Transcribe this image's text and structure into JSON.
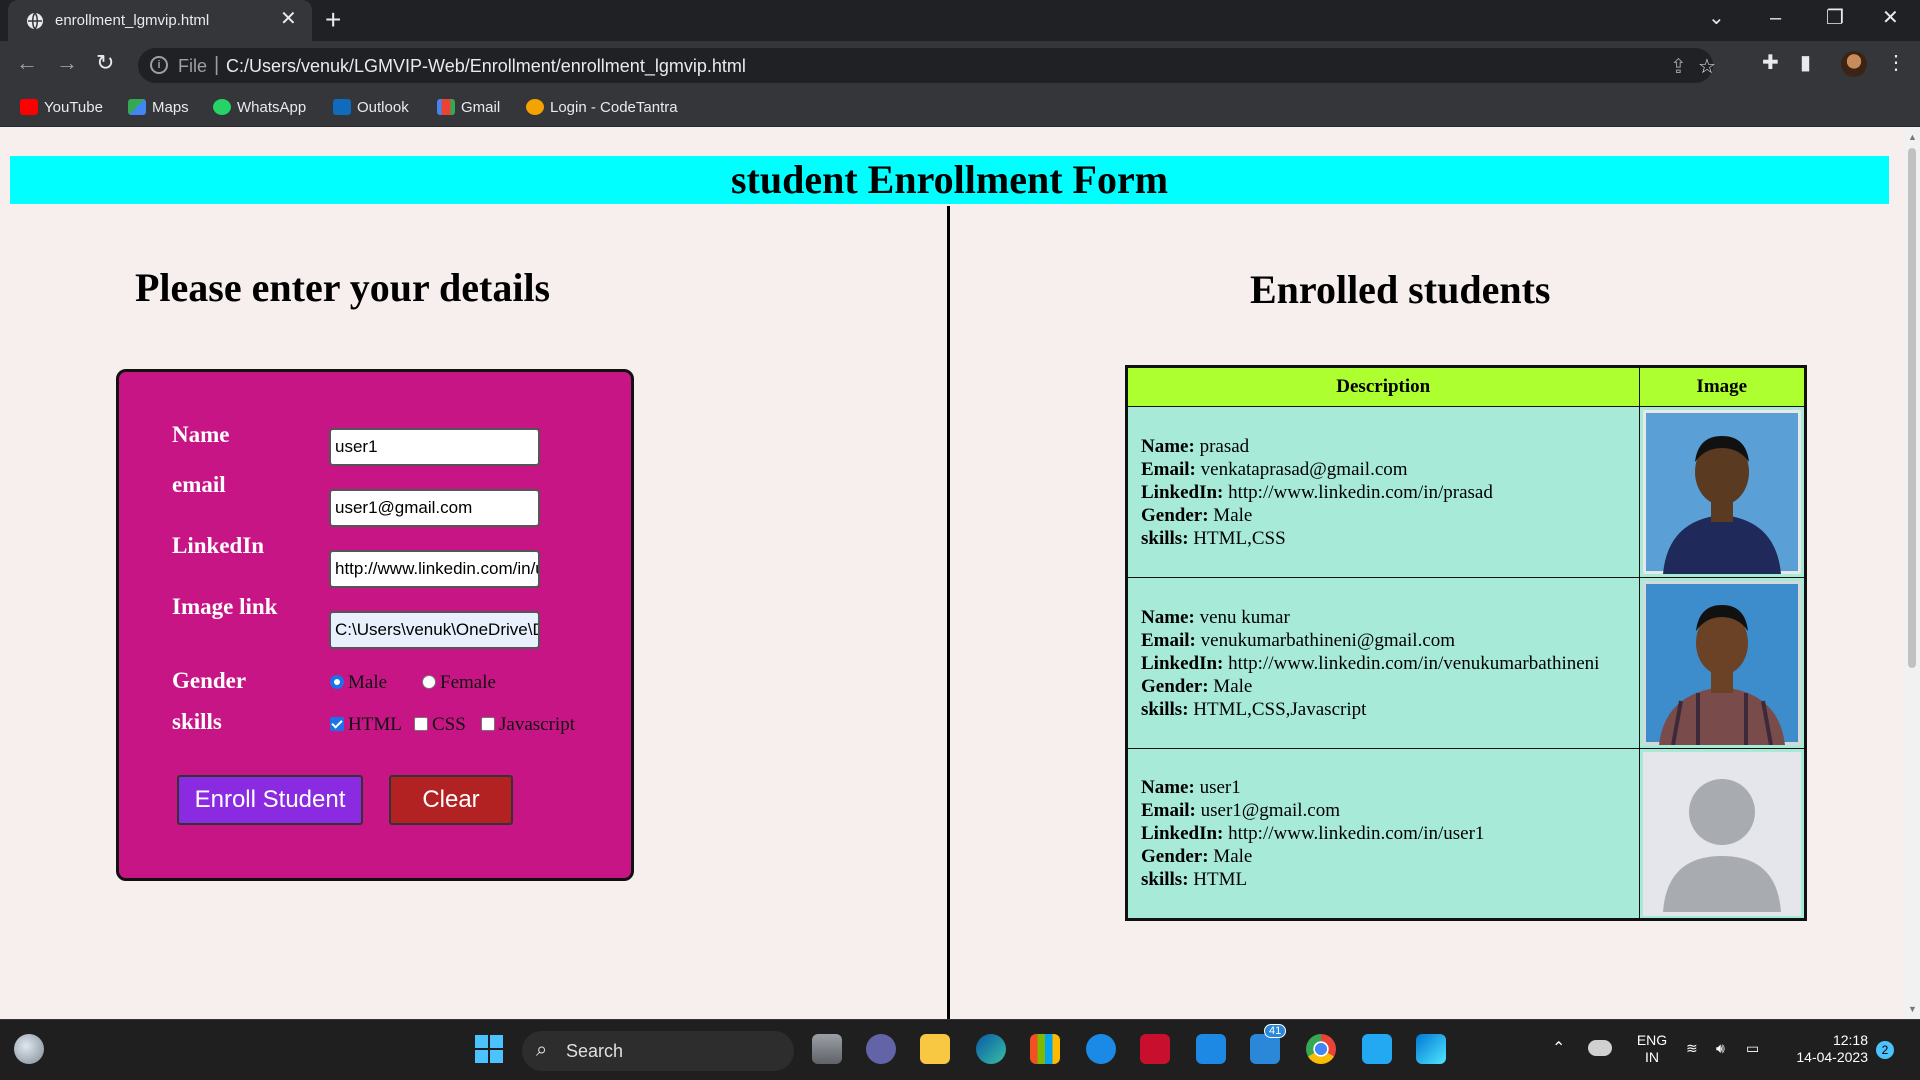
{
  "browser": {
    "tab_title": "enrollment_lgmvip.html",
    "tab_close": "✕",
    "new_tab": "+",
    "url_scheme": "File",
    "url_separator": "|",
    "url": "C:/Users/venuk/LGMVIP-Web/Enrollment/enrollment_lgmvip.html",
    "bookmarks": [
      {
        "label": "YouTube",
        "icon": "youtube-icon",
        "color": "#ff0000"
      },
      {
        "label": "Maps",
        "icon": "maps-icon",
        "color": "#34a853"
      },
      {
        "label": "WhatsApp",
        "icon": "whatsapp-icon",
        "color": "#25d366"
      },
      {
        "label": "Outlook",
        "icon": "outlook-icon",
        "color": "#0f6cbd"
      },
      {
        "label": "Gmail",
        "icon": "gmail-icon",
        "color": "#ea4335"
      },
      {
        "label": "Login - CodeTantra",
        "icon": "codetantra-icon",
        "color": "#f4a300"
      }
    ]
  },
  "page": {
    "banner": "student Enrollment Form",
    "form_heading": "Please enter your details",
    "list_heading": "Enrolled students"
  },
  "form": {
    "name_label": "Name",
    "name_value": "user1",
    "email_label": "email",
    "email_value": "user1@gmail.com",
    "linkedin_label": "LinkedIn",
    "linkedin_value": "http://www.linkedin.com/in/u",
    "image_label": "Image link",
    "image_value": "C:\\Users\\venuk\\OneDrive\\D",
    "gender_label": "Gender",
    "gender_male": "Male",
    "gender_female": "Female",
    "gender_selected": "Male",
    "skills_label": "skills",
    "skill_html": "HTML",
    "skill_css": "CSS",
    "skill_js": "Javascript",
    "skills_checked": [
      "HTML"
    ],
    "enroll_button": "Enroll Student",
    "clear_button": "Clear",
    "colors": {
      "form_bg": "#c71585",
      "enroll_bg": "#8a2be2",
      "clear_bg": "#b22222",
      "banner_bg": "#00ffff",
      "table_header_bg": "#adff2f",
      "table_cell_bg": "#a8ead8"
    }
  },
  "table": {
    "headers": [
      "Description",
      "Image"
    ],
    "field_labels": {
      "name": "Name:",
      "email": "Email:",
      "linkedin": "LinkedIn:",
      "gender": "Gender:",
      "skills": "skills:"
    },
    "rows": [
      {
        "name": "prasad",
        "email": "venkataprasad@gmail.com",
        "linkedin": "http://www.linkedin.com/in/prasad",
        "gender": "Male",
        "skills": "HTML,CSS",
        "image": "student-photo-1"
      },
      {
        "name": "venu kumar",
        "email": "venukumarbathineni@gmail.com",
        "linkedin": "http://www.linkedin.com/in/venukumarbathineni",
        "gender": "Male",
        "skills": "HTML,CSS,Javascript",
        "image": "student-photo-2"
      },
      {
        "name": "user1",
        "email": "user1@gmail.com",
        "linkedin": "http://www.linkedin.com/in/user1",
        "gender": "Male",
        "skills": "HTML",
        "image": "default-avatar"
      }
    ]
  },
  "taskbar": {
    "search_label": "Search",
    "language": "ENG",
    "region": "IN",
    "time": "12:18",
    "date": "14-04-2023",
    "notification_count": "2",
    "badge_count": "41"
  }
}
